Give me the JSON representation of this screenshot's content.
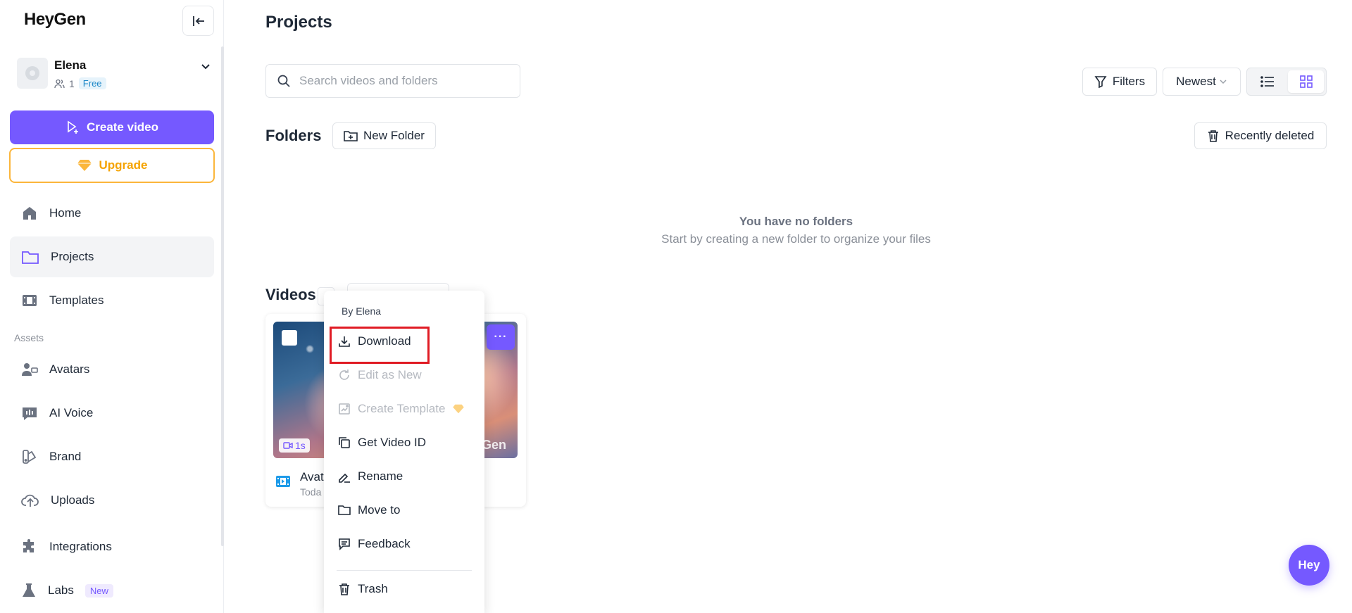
{
  "app": {
    "logo": "HeyGen"
  },
  "account": {
    "name": "Elena",
    "members": "1",
    "plan": "Free"
  },
  "sidebar": {
    "create_label": "Create video",
    "upgrade_label": "Upgrade",
    "assets_label": "Assets",
    "items": [
      {
        "label": "Home",
        "icon": "home-icon"
      },
      {
        "label": "Projects",
        "icon": "folder-icon"
      },
      {
        "label": "Templates",
        "icon": "film-icon"
      },
      {
        "label": "Avatars",
        "icon": "avatar-icon"
      },
      {
        "label": "AI Voice",
        "icon": "voice-icon"
      },
      {
        "label": "Brand",
        "icon": "brand-icon"
      },
      {
        "label": "Uploads",
        "icon": "upload-icon"
      },
      {
        "label": "Integrations",
        "icon": "puzzle-icon"
      },
      {
        "label": "Labs",
        "icon": "flask-icon",
        "badge": "New"
      }
    ]
  },
  "main": {
    "title": "Projects",
    "search": {
      "placeholder": "Search videos and folders",
      "value": ""
    },
    "filters_label": "Filters",
    "sort_label": "Newest",
    "folders": {
      "title": "Folders",
      "new_label": "New Folder",
      "recent_label": "Recently deleted",
      "empty_title": "You have no folders",
      "empty_subtitle": "Start by creating a new folder to organize your files"
    },
    "videos": {
      "title": "Videos",
      "card": {
        "title": "Avat",
        "date": "Toda",
        "duration": "1s",
        "watermark": "Gen",
        "more": "···"
      }
    }
  },
  "menu": {
    "header": "By Elena",
    "items": [
      {
        "label": "Download",
        "icon": "download-icon",
        "enabled": true
      },
      {
        "label": "Edit as New",
        "icon": "refresh-icon",
        "enabled": false
      },
      {
        "label": "Create Template",
        "icon": "template-icon",
        "enabled": false
      },
      {
        "label": "Get Video ID",
        "icon": "copy-icon",
        "enabled": true
      },
      {
        "label": "Rename",
        "icon": "rename-icon",
        "enabled": true
      },
      {
        "label": "Move to",
        "icon": "folder-icon",
        "enabled": true
      },
      {
        "label": "Feedback",
        "icon": "feedback-icon",
        "enabled": true
      },
      {
        "label": "Trash",
        "icon": "trash-icon",
        "enabled": true
      }
    ]
  },
  "chat": {
    "label": "Hey"
  },
  "colors": {
    "accent": "#7559ff",
    "upgrade": "#fbb63b",
    "highlight": "#e01b24"
  }
}
